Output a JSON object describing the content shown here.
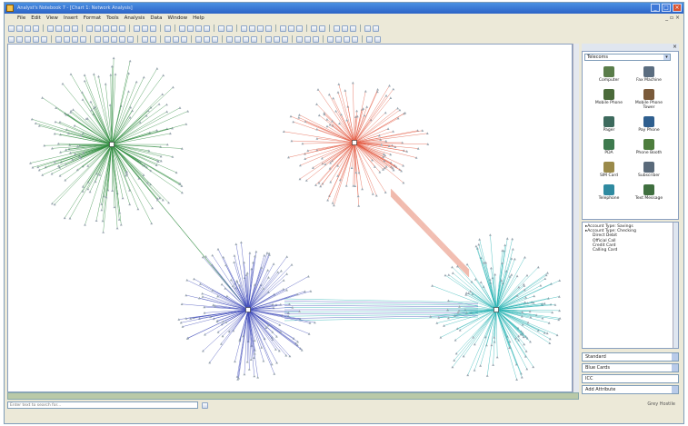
{
  "window": {
    "title": "Analyst's Notebook 7 - [Chart 1: Network Analysis]"
  },
  "menu": [
    "File",
    "Edit",
    "View",
    "Insert",
    "Format",
    "Tools",
    "Analysis",
    "Data",
    "Window",
    "Help"
  ],
  "palette": {
    "category": "Telecoms",
    "items": [
      {
        "label": "Computer",
        "icon": "computer-icon",
        "color": "#5a7d4a"
      },
      {
        "label": "Fax Machine",
        "icon": "fax-machine-icon",
        "color": "#5b6d80"
      },
      {
        "label": "Mobile Phone",
        "icon": "mobile-phone-icon",
        "color": "#4a6a3a"
      },
      {
        "label": "Mobile Phone Tower",
        "icon": "phone-tower-icon",
        "color": "#7a5a3a"
      },
      {
        "label": "Pager",
        "icon": "pager-icon",
        "color": "#3d6a5d"
      },
      {
        "label": "Pay Phone",
        "icon": "pay-phone-icon",
        "color": "#2f5f8f"
      },
      {
        "label": "PDA",
        "icon": "pda-icon",
        "color": "#3e7a4e"
      },
      {
        "label": "Phone Booth",
        "icon": "phone-booth-icon",
        "color": "#4d7d3d"
      },
      {
        "label": "SIM Card",
        "icon": "sim-card-icon",
        "color": "#9a8a4a"
      },
      {
        "label": "Subscriber",
        "icon": "subscriber-icon",
        "color": "#5a6a7a"
      },
      {
        "label": "Telephone",
        "icon": "telephone-icon",
        "color": "#2f8aa0"
      },
      {
        "label": "Text Message",
        "icon": "text-message-icon",
        "color": "#3f6f3f"
      }
    ]
  },
  "attributes": {
    "items": [
      {
        "text": "Account Type: Savings",
        "level": 0
      },
      {
        "text": "Account Type: Checking",
        "level": 0
      },
      {
        "text": "Direct Debit",
        "level": 1
      },
      {
        "text": "Official Call",
        "level": 1
      },
      {
        "text": "Credit Card",
        "level": 1
      },
      {
        "text": "Calling Card",
        "level": 1
      }
    ]
  },
  "properties": {
    "style": "Standard",
    "color": "Blue Cards",
    "value": "ICC",
    "add_attribute": "Add Attribute"
  },
  "statusbar": {
    "find_placeholder": "Enter text to search for...",
    "right_text": "Grey Hostile"
  },
  "network": {
    "clusters": [
      {
        "name": "green-cluster",
        "color": "#2e8b3e",
        "leaves": 170
      },
      {
        "name": "red-cluster",
        "color": "#e2553c",
        "leaves": 130
      },
      {
        "name": "blue-cluster",
        "color": "#3d48b8",
        "leaves": 150
      },
      {
        "name": "cyan-cluster",
        "color": "#27b3b3",
        "leaves": 150
      }
    ]
  }
}
